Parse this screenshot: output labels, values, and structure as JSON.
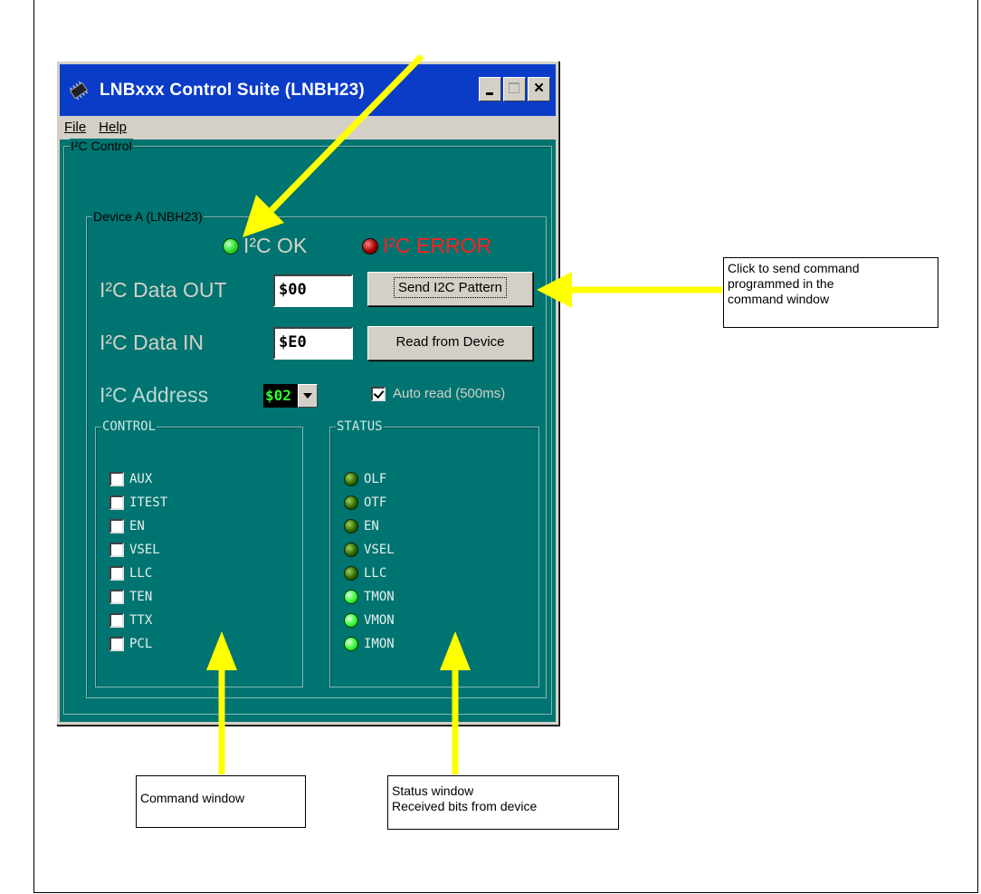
{
  "window": {
    "title": "LNBxxx Control Suite  (LNBH23)"
  },
  "menu": {
    "file": "File",
    "help": "Help"
  },
  "groups": {
    "i2c_control": "I²C Control",
    "device": "Device A (LNBH23)",
    "control": "CONTROL",
    "status": "STATUS"
  },
  "indicators": {
    "ok": "I²C OK",
    "error": "I²C ERROR"
  },
  "fields": {
    "data_out_label": "I²C Data  OUT",
    "data_out_value": "$00",
    "data_in_label": "I²C Data IN",
    "data_in_value": "$E0",
    "address_label": "I²C Address",
    "address_value": "$02"
  },
  "buttons": {
    "send": "Send I2C Pattern",
    "read": "Read from Device"
  },
  "auto_read": {
    "label": "Auto read (500ms)",
    "checked": true
  },
  "control_items": [
    "AUX",
    "ITEST",
    "EN",
    "VSEL",
    "LLC",
    "TEN",
    "TTX",
    "PCL"
  ],
  "status_items": [
    {
      "label": "OLF",
      "state": "dim"
    },
    {
      "label": "OTF",
      "state": "dim"
    },
    {
      "label": "EN",
      "state": "dim"
    },
    {
      "label": "VSEL",
      "state": "dim"
    },
    {
      "label": "LLC",
      "state": "dim"
    },
    {
      "label": "TMON",
      "state": "on"
    },
    {
      "label": "VMON",
      "state": "on"
    },
    {
      "label": "IMON",
      "state": "on"
    }
  ],
  "callouts": {
    "send": [
      "Click to send command",
      "programmed in the",
      "command window"
    ],
    "command": "Command window",
    "status": [
      "Status window",
      "Received bits from  device"
    ]
  },
  "colors": {
    "titlebar": "#0a3cc8",
    "client": "#007470",
    "arrow": "#ffff00",
    "error": "#ff2020"
  }
}
